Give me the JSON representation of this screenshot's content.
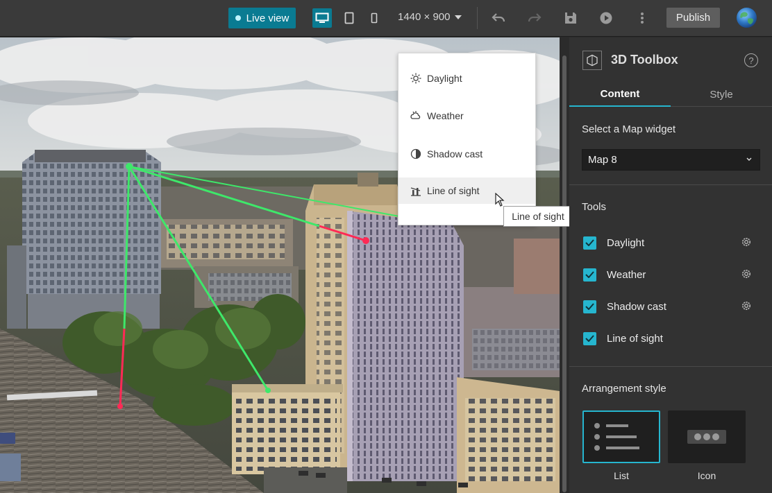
{
  "toolbar": {
    "live_view_label": "Live view",
    "resolution": "1440 × 900",
    "publish_label": "Publish"
  },
  "tool_menu": {
    "items": [
      {
        "label": "Daylight",
        "icon": "sun-icon"
      },
      {
        "label": "Weather",
        "icon": "cloud-icon"
      },
      {
        "label": "Shadow cast",
        "icon": "shadow-icon"
      },
      {
        "label": "Line of sight",
        "icon": "line-of-sight-icon"
      }
    ],
    "hovered_index": 3,
    "tooltip": "Line of sight"
  },
  "panel": {
    "title": "3D Toolbox",
    "tabs": [
      {
        "label": "Content",
        "active": true
      },
      {
        "label": "Style",
        "active": false
      }
    ],
    "map_widget_label": "Select a Map widget",
    "map_widget_value": "Map 8",
    "tools_label": "Tools",
    "tools": [
      {
        "label": "Daylight",
        "checked": true,
        "has_settings": true
      },
      {
        "label": "Weather",
        "checked": true,
        "has_settings": true
      },
      {
        "label": "Shadow cast",
        "checked": true,
        "has_settings": true
      },
      {
        "label": "Line of sight",
        "checked": true,
        "has_settings": false
      }
    ],
    "arrangement_label": "Arrangement style",
    "arrangement_options": [
      {
        "label": "List",
        "selected": true
      },
      {
        "label": "Icon",
        "selected": false
      }
    ]
  },
  "colors": {
    "accent": "#26b6cf",
    "live_button": "#0a7b92",
    "visible_line": "#3ee86a",
    "obstructed_line": "#ff2a55"
  }
}
